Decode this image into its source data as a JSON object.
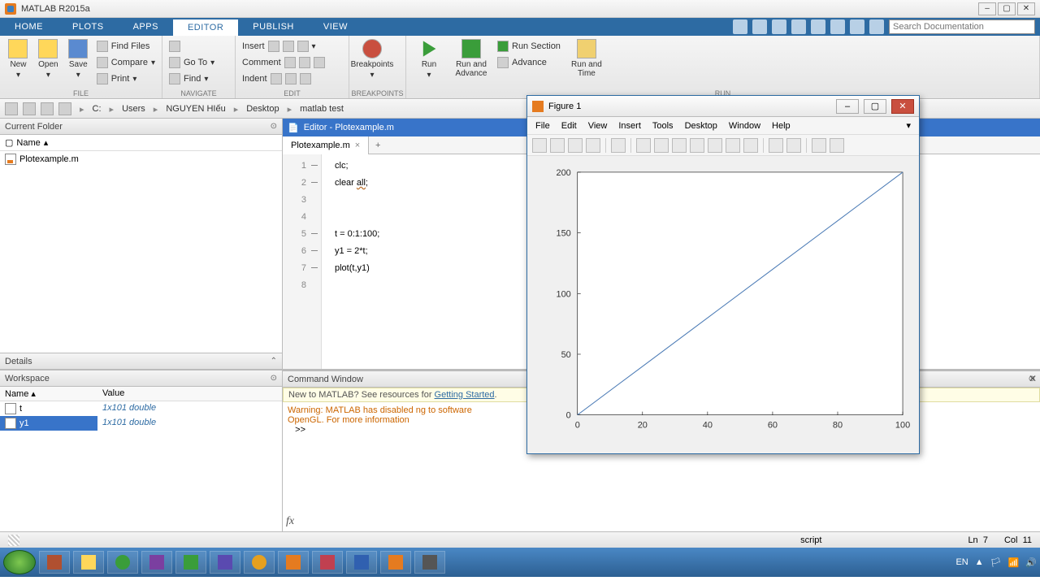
{
  "title": "MATLAB R2015a",
  "tabs": [
    "HOME",
    "PLOTS",
    "APPS",
    "EDITOR",
    "PUBLISH",
    "VIEW"
  ],
  "activeTab": 3,
  "searchPlaceholder": "Search Documentation",
  "toolstrip": {
    "file": {
      "label": "FILE",
      "new": "New",
      "open": "Open",
      "save": "Save",
      "findFiles": "Find Files",
      "compare": "Compare",
      "print": "Print"
    },
    "navigate": {
      "label": "NAVIGATE",
      "goto": "Go To",
      "find": "Find"
    },
    "edit": {
      "label": "EDIT",
      "insert": "Insert",
      "comment": "Comment",
      "indent": "Indent"
    },
    "breakpoints": {
      "label": "BREAKPOINTS",
      "btn": "Breakpoints"
    },
    "run": {
      "label": "RUN",
      "run": "Run",
      "runAdvance": "Run and\nAdvance",
      "runSection": "Run Section",
      "advance": "Advance",
      "runTime": "Run and\nTime"
    }
  },
  "path": [
    "C:",
    "Users",
    "NGUYEN HIếu",
    "Desktop",
    "matlab test"
  ],
  "currentFolder": {
    "title": "Current Folder",
    "colName": "Name",
    "files": [
      "Plotexample.m"
    ]
  },
  "details": {
    "title": "Details"
  },
  "workspace": {
    "title": "Workspace",
    "colName": "Name",
    "colValue": "Value",
    "vars": [
      {
        "name": "t",
        "value": "1x101 double"
      },
      {
        "name": "y1",
        "value": "1x101 double"
      }
    ],
    "selected": 1
  },
  "editor": {
    "title": "Editor - Plotexample.m",
    "tab": "Plotexample.m",
    "lines": [
      {
        "n": 1,
        "dash": true,
        "text": "clc;"
      },
      {
        "n": 2,
        "dash": true,
        "html": "clear <span class='uv'>all</span>;"
      },
      {
        "n": 3,
        "dash": false,
        "text": ""
      },
      {
        "n": 4,
        "dash": false,
        "text": ""
      },
      {
        "n": 5,
        "dash": true,
        "text": "t = 0:1:100;"
      },
      {
        "n": 6,
        "dash": true,
        "text": "y1 = 2*t;"
      },
      {
        "n": 7,
        "dash": true,
        "text": "plot(t,y1)"
      },
      {
        "n": 8,
        "dash": false,
        "text": ""
      }
    ]
  },
  "cmdwin": {
    "title": "Command Window",
    "info": "New to MATLAB? See resources for ",
    "infoLink": "Getting Started",
    "warn1": "Warning: MATLAB has disabled                              ng to software",
    "warn2": "OpenGL. For more information",
    "prompt": ">> "
  },
  "status": {
    "type": "script",
    "ln": "Ln",
    "lnv": "7",
    "col": "Col",
    "colv": "11"
  },
  "tray": {
    "lang": "EN"
  },
  "figure": {
    "title": "Figure 1",
    "menus": [
      "File",
      "Edit",
      "View",
      "Insert",
      "Tools",
      "Desktop",
      "Window",
      "Help"
    ]
  },
  "chart_data": {
    "type": "line",
    "x": [
      0,
      20,
      40,
      60,
      80,
      100
    ],
    "y": [
      0,
      40,
      80,
      120,
      160,
      200
    ],
    "xlim": [
      0,
      100
    ],
    "ylim": [
      0,
      200
    ],
    "xticks": [
      0,
      20,
      40,
      60,
      80,
      100
    ],
    "yticks": [
      0,
      50,
      100,
      150,
      200
    ]
  }
}
